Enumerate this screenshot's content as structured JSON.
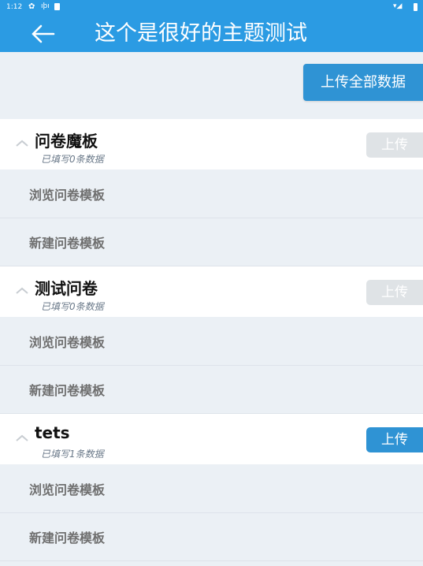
{
  "status_bar": {
    "time": "1:12",
    "gear_icon": "gear-icon",
    "signal_icon": "vibrate-icon",
    "sd_icon": "sd-card-icon",
    "wifi_icon": "wifi-icon",
    "battery_icon": "battery-icon"
  },
  "app_bar": {
    "title": "这个是很好的主题测试",
    "back_icon": "arrow-back-icon",
    "background": "#2b9be3"
  },
  "upload_all": {
    "label": "上传全部数据",
    "color": "#2f93d4"
  },
  "groups": [
    {
      "title": "问卷魔板",
      "subtitle": "已填写0条数据",
      "upload_label": "上传",
      "upload_enabled": false,
      "items": [
        {
          "label": "浏览问卷模板"
        },
        {
          "label": "新建问卷模板"
        }
      ]
    },
    {
      "title": "测试问卷",
      "subtitle": "已填写0条数据",
      "upload_label": "上传",
      "upload_enabled": false,
      "items": [
        {
          "label": "浏览问卷模板"
        },
        {
          "label": "新建问卷模板"
        }
      ]
    },
    {
      "title": "tets",
      "subtitle": "已填写1条数据",
      "upload_label": "上传",
      "upload_enabled": true,
      "items": [
        {
          "label": "浏览问卷模板"
        },
        {
          "label": "新建问卷模板"
        }
      ]
    }
  ]
}
